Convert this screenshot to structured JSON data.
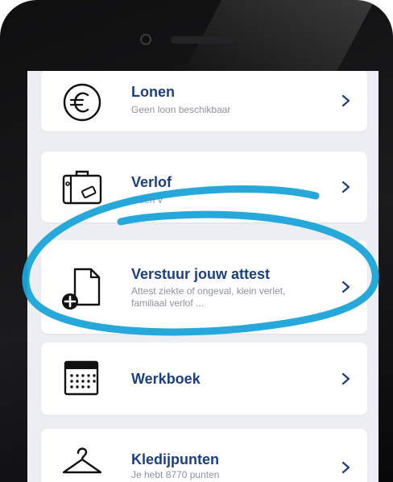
{
  "items": [
    {
      "title": "Lonen",
      "subtitle": "Geen loon beschikbaar",
      "icon": "euro-icon"
    },
    {
      "title": "Verlof",
      "subtitle": "Geen v",
      "icon": "suitcase-icon"
    },
    {
      "title": "Verstuur jouw attest",
      "subtitle_lines": [
        "Attest ziekte of ongeval, klein verlet,",
        "familiaal verlof ..."
      ],
      "icon": "document-add-icon"
    },
    {
      "title": "Werkboek",
      "icon": "calendar-icon"
    },
    {
      "title": "Kledijpunten",
      "subtitle": "Je hebt 8770 punten",
      "icon": "hanger-icon"
    }
  ],
  "colors": {
    "title": "#1b3e85",
    "highlight": "#1aa3d8",
    "background": "#eceef3"
  }
}
